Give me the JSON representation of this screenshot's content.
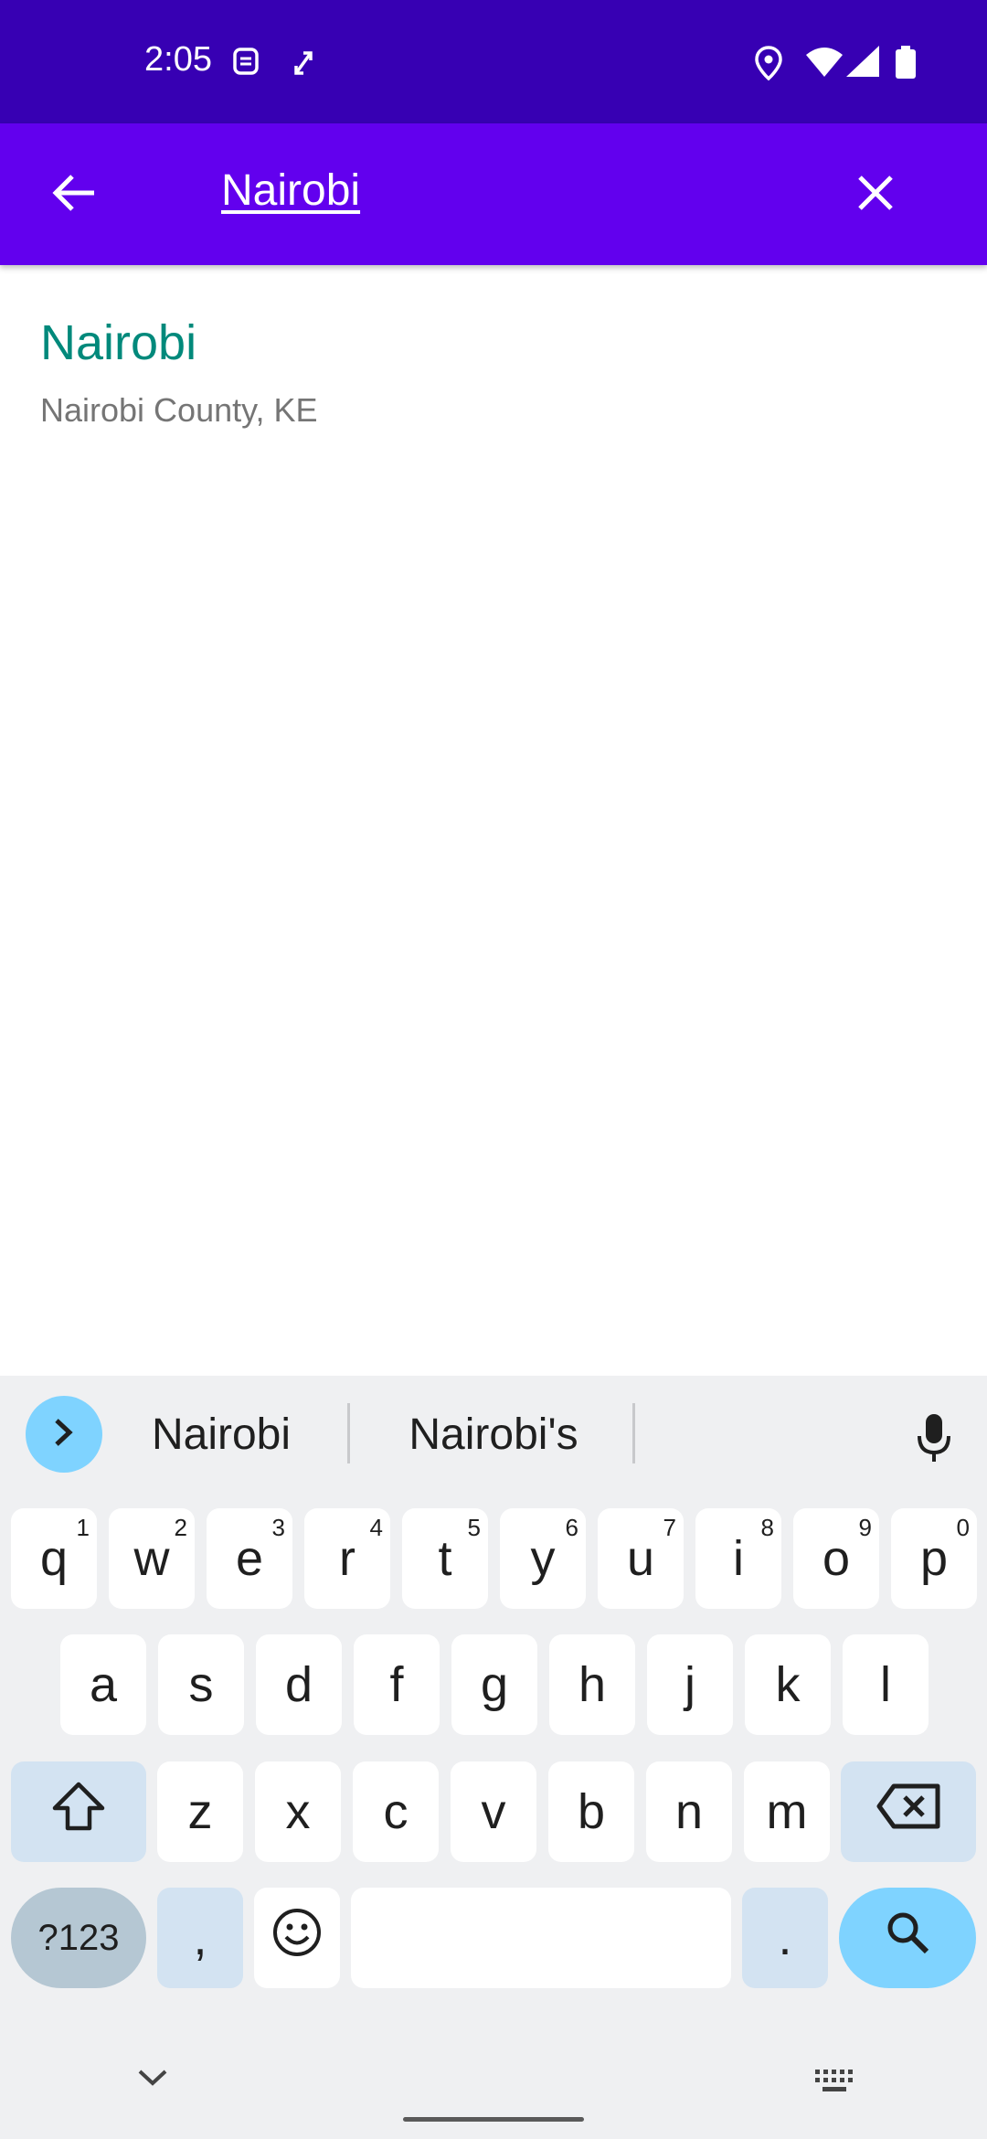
{
  "status_bar": {
    "time": "2:05",
    "icons": [
      "notification-icon",
      "sync-icon",
      "location-icon",
      "wifi-icon",
      "signal-icon",
      "battery-icon"
    ],
    "background": "#3700b3"
  },
  "app_bar": {
    "search_value": "Nairobi",
    "background": "#6200ee",
    "back_icon": "arrow-back-icon",
    "clear_icon": "close-icon"
  },
  "results": [
    {
      "title": "Nairobi",
      "subtitle": "Nairobi County, KE"
    }
  ],
  "keyboard": {
    "suggestions": [
      "Nairobi",
      "Nairobi's"
    ],
    "rows": [
      [
        {
          "label": "q",
          "sup": "1"
        },
        {
          "label": "w",
          "sup": "2"
        },
        {
          "label": "e",
          "sup": "3"
        },
        {
          "label": "r",
          "sup": "4"
        },
        {
          "label": "t",
          "sup": "5"
        },
        {
          "label": "y",
          "sup": "6"
        },
        {
          "label": "u",
          "sup": "7"
        },
        {
          "label": "i",
          "sup": "8"
        },
        {
          "label": "o",
          "sup": "9"
        },
        {
          "label": "p",
          "sup": "0"
        }
      ],
      [
        {
          "label": "a"
        },
        {
          "label": "s"
        },
        {
          "label": "d"
        },
        {
          "label": "f"
        },
        {
          "label": "g"
        },
        {
          "label": "h"
        },
        {
          "label": "j"
        },
        {
          "label": "k"
        },
        {
          "label": "l"
        }
      ],
      [
        {
          "label": "z"
        },
        {
          "label": "x"
        },
        {
          "label": "c"
        },
        {
          "label": "v"
        },
        {
          "label": "b"
        },
        {
          "label": "n"
        },
        {
          "label": "m"
        }
      ]
    ],
    "symbols_label": "?123",
    "comma_label": ",",
    "period_label": ".",
    "accent": "#7fd3ff"
  }
}
